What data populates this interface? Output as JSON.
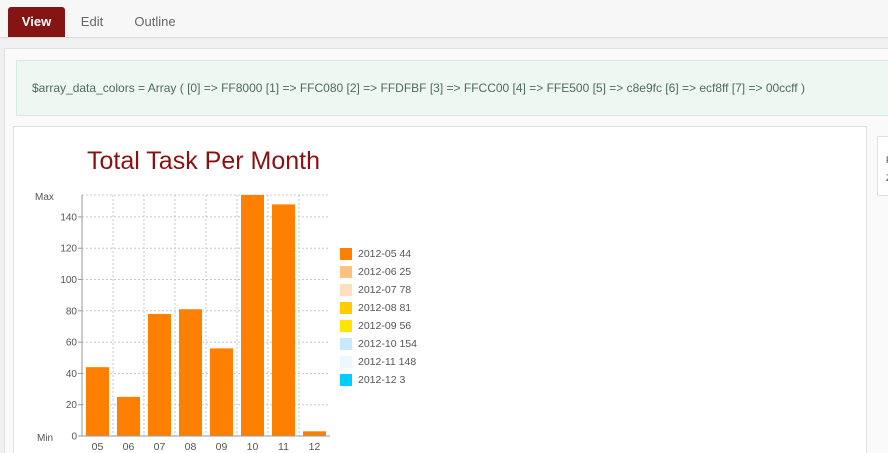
{
  "tabs": [
    {
      "label": "View",
      "active": true
    },
    {
      "label": "Edit",
      "active": false
    },
    {
      "label": "Outline",
      "active": false
    }
  ],
  "debug_output": "$array_data_colors = Array ( [0] => FF8000 [1] => FFC080 [2] => FFDFBF [3] => FFCC00 [4] => FFE500 [5] => c8e9fc [6] => ecf8ff [7] => 00ccff )",
  "sidebar_text": [
    "F",
    "Z"
  ],
  "chart_data": {
    "type": "bar",
    "title": "Total Task Per Month",
    "categories": [
      "05",
      "06",
      "07",
      "08",
      "09",
      "10",
      "11",
      "12"
    ],
    "values": [
      44,
      25,
      78,
      81,
      56,
      154,
      148,
      3
    ],
    "y_ticks": [
      0,
      20,
      40,
      60,
      80,
      100,
      120,
      140
    ],
    "y_max_label": "Max",
    "y_min_label": "Min",
    "ylim": [
      0,
      154
    ],
    "bar_color": "#FF8000",
    "grid": true,
    "legend_position": "right",
    "legend": [
      {
        "label": "2012-05 44",
        "color": "#FF8000"
      },
      {
        "label": "2012-06 25",
        "color": "#FFC080"
      },
      {
        "label": "2012-07 78",
        "color": "#FFDFBF"
      },
      {
        "label": "2012-08 81",
        "color": "#FFCC00"
      },
      {
        "label": "2012-09 56",
        "color": "#FFE500"
      },
      {
        "label": "2012-10 154",
        "color": "#c8e9fc"
      },
      {
        "label": "2012-11 148",
        "color": "#ecf8ff"
      },
      {
        "label": "2012-12 3",
        "color": "#00ccff"
      }
    ]
  }
}
